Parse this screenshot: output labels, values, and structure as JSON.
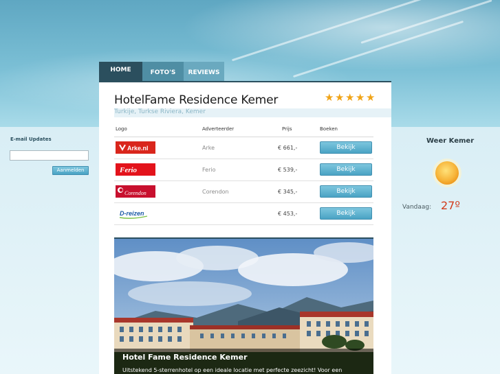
{
  "nav": {
    "tabs": [
      {
        "label": "HOME",
        "active": true
      },
      {
        "label": "FOTO'S",
        "active": false
      },
      {
        "label": "REVIEWS",
        "active": false
      }
    ]
  },
  "hotel": {
    "title": "HotelFame Residence Kemer",
    "location": "Turkije, Turkse Riviera, Kemer",
    "rating_stars": 5
  },
  "offers": {
    "headers": {
      "logo": "Logo",
      "advertiser": "Adverteerder",
      "price": "Prijs",
      "book": "Boeken"
    },
    "rows": [
      {
        "logo_text": "Arke.nl",
        "advertiser": "Arke",
        "price": "€ 661,-",
        "button": "Bekijk"
      },
      {
        "logo_text": "Ferio",
        "advertiser": "Ferio",
        "price": "€ 539,-",
        "button": "Bekijk"
      },
      {
        "logo_text": "Corendon",
        "advertiser": "Corendon",
        "price": "€ 345,-",
        "button": "Bekijk"
      },
      {
        "logo_text": "D-reizen",
        "advertiser": "",
        "price": "€ 453,-",
        "button": "Bekijk"
      }
    ]
  },
  "photo": {
    "caption_title": "Hotel Fame Residence Kemer",
    "caption_text": "Uitstekend 5-sterrenhotel op een ideale locatie met perfecte zeezicht! Voor een"
  },
  "sidebar_left": {
    "email_label": "E-mail Updates",
    "email_value": "",
    "button_label": "Aanmelden"
  },
  "weather": {
    "title": "Weer Kemer",
    "today_label": "Vandaag:",
    "temperature": "27º",
    "icon": "sun-icon"
  },
  "colors": {
    "nav_active": "#2b4f5e",
    "button": "#4aa3c4",
    "star": "#f0a418",
    "temperature": "#d23a1a"
  }
}
